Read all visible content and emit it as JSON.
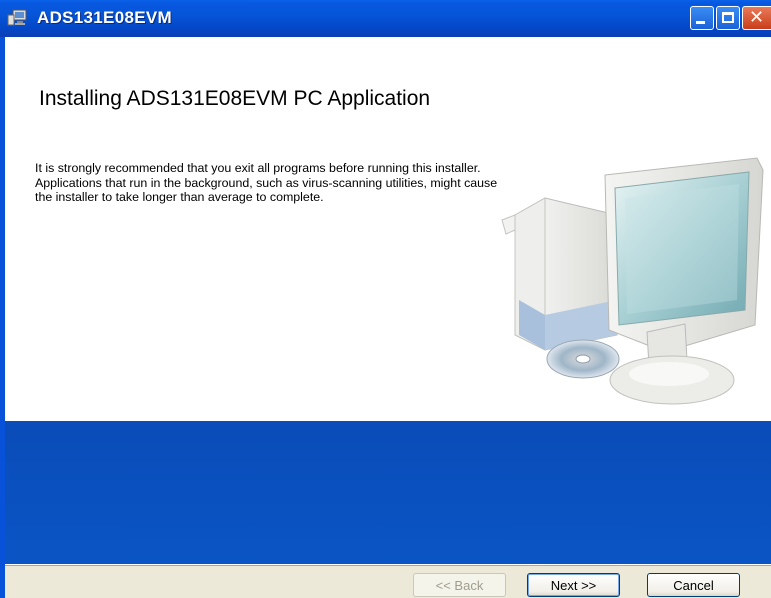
{
  "window": {
    "title": "ADS131E08EVM",
    "icon": "setup-computer-icon",
    "controls": [
      "minimize",
      "maximize",
      "close"
    ],
    "close_glyph": "✕"
  },
  "main": {
    "heading": "Installing ADS131E08EVM PC Application",
    "description": "It is strongly recommended that you exit all programs before running this installer. Applications that run in the background, such as virus-scanning utilities, might cause the installer to take longer than average to complete.",
    "illustration": "computer-with-disc-icon"
  },
  "footer": {
    "back_label": "<< Back",
    "next_label": "Next >>",
    "cancel_label": "Cancel",
    "back_enabled": false
  },
  "colors": {
    "title_bar": "#0655d8",
    "band": "#0a4cb8",
    "footer_bg": "#ece9d8"
  }
}
